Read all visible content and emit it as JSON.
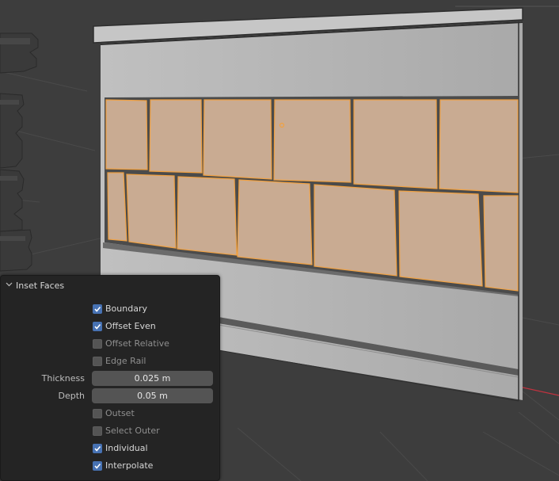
{
  "panel": {
    "title": "Inset Faces",
    "options": [
      {
        "label": "Boundary",
        "checked": true
      },
      {
        "label": "Offset Even",
        "checked": true
      },
      {
        "label": "Offset Relative",
        "checked": false
      },
      {
        "label": "Edge Rail",
        "checked": false
      }
    ],
    "thickness": {
      "label": "Thickness",
      "value": "0.025 m"
    },
    "depth": {
      "label": "Depth",
      "value": "0.05 m"
    },
    "options2": [
      {
        "label": "Outset",
        "checked": false
      },
      {
        "label": "Select Outer",
        "checked": false
      },
      {
        "label": "Individual",
        "checked": true
      },
      {
        "label": "Interpolate",
        "checked": true
      }
    ]
  },
  "colors": {
    "viewport_bg": "#3d3d3d",
    "selected_face": "#c9ab92",
    "selected_edge": "#f0a142",
    "wall": "#b8b8b8",
    "checkbox_on": "#4772b3",
    "x_axis": "#c1323f"
  }
}
